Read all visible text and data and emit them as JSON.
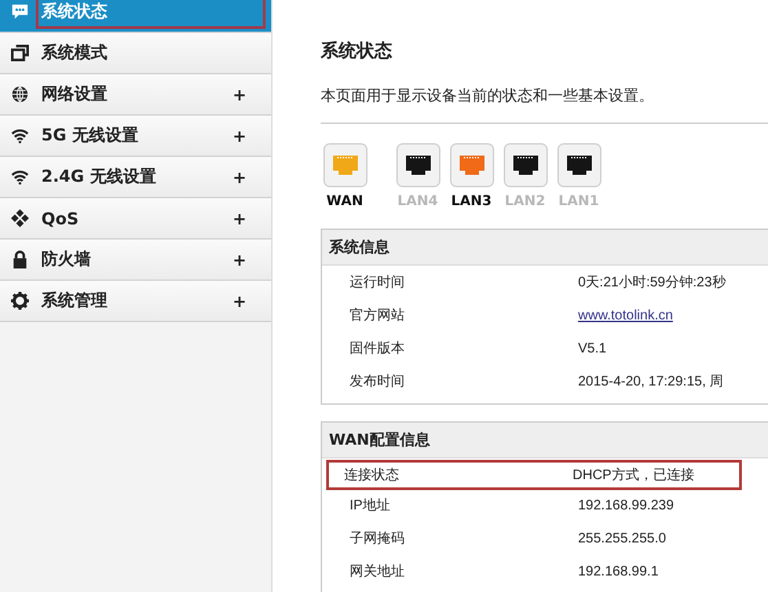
{
  "sidebar": {
    "items": [
      {
        "label": "系统状态",
        "selected": true
      },
      {
        "label": "系统模式",
        "selected": false
      },
      {
        "label": "网络设置",
        "selected": false,
        "toggle": "+"
      },
      {
        "label": "5G 无线设置",
        "selected": false,
        "toggle": "+"
      },
      {
        "label": "2.4G 无线设置",
        "selected": false,
        "toggle": "+"
      },
      {
        "label": "QoS",
        "selected": false,
        "toggle": "+"
      },
      {
        "label": "防火墙",
        "selected": false,
        "toggle": "+"
      },
      {
        "label": "系统管理",
        "selected": false,
        "toggle": "+"
      }
    ]
  },
  "page": {
    "title": "系统状态",
    "description": "本页面用于显示设备当前的状态和一些基本设置。"
  },
  "ports": [
    {
      "label": "WAN",
      "active": true,
      "color": "#f0a818"
    },
    {
      "label": "LAN4",
      "active": false,
      "color": "#151515"
    },
    {
      "label": "LAN3",
      "active": true,
      "color": "#f06a18"
    },
    {
      "label": "LAN2",
      "active": false,
      "color": "#151515"
    },
    {
      "label": "LAN1",
      "active": false,
      "color": "#151515"
    }
  ],
  "sections": [
    {
      "title": "系统信息",
      "rows": [
        {
          "label": "运行时间",
          "value": "0天:21小时:59分钟:23秒",
          "kind": "text",
          "highlighted": false
        },
        {
          "label": "官方网站",
          "value": "www.totolink.cn",
          "kind": "link",
          "highlighted": false
        },
        {
          "label": "固件版本",
          "value": "V5.1",
          "kind": "text",
          "highlighted": false
        },
        {
          "label": "发布时间",
          "value": "2015-4-20, 17:29:15, 周",
          "kind": "text",
          "highlighted": false
        }
      ]
    },
    {
      "title": "WAN配置信息",
      "rows": [
        {
          "label": "连接状态",
          "value": "DHCP方式，已连接",
          "kind": "text",
          "highlighted": true
        },
        {
          "label": "IP地址",
          "value": "192.168.99.239",
          "kind": "text",
          "highlighted": false
        },
        {
          "label": "子网掩码",
          "value": "255.255.255.0",
          "kind": "text",
          "highlighted": false
        },
        {
          "label": "网关地址",
          "value": "192.168.99.1",
          "kind": "text",
          "highlighted": false
        }
      ]
    }
  ]
}
